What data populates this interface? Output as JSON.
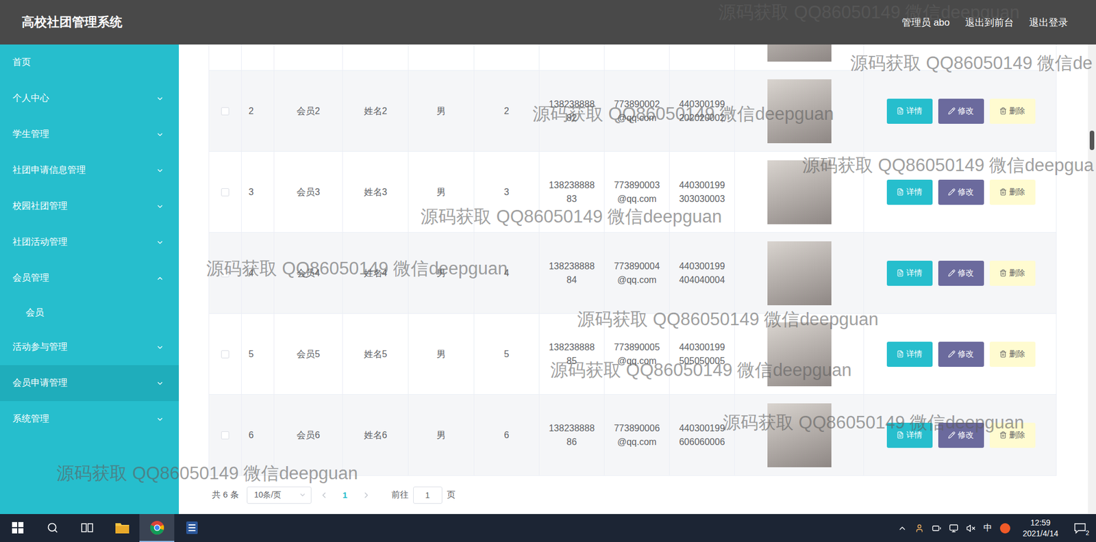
{
  "header": {
    "title": "高校社团管理系统",
    "links": [
      "管理员 abo",
      "退出到前台",
      "退出登录"
    ]
  },
  "sidebar": {
    "items": [
      {
        "label": "首页",
        "kind": "item",
        "expandable": false,
        "expanded": false,
        "highlighted": false
      },
      {
        "label": "个人中心",
        "kind": "item",
        "expandable": true,
        "expanded": false,
        "highlighted": false
      },
      {
        "label": "学生管理",
        "kind": "item",
        "expandable": true,
        "expanded": false,
        "highlighted": false
      },
      {
        "label": "社团申请信息管理",
        "kind": "item",
        "expandable": true,
        "expanded": false,
        "highlighted": false
      },
      {
        "label": "校园社团管理",
        "kind": "item",
        "expandable": true,
        "expanded": false,
        "highlighted": false
      },
      {
        "label": "社团活动管理",
        "kind": "item",
        "expandable": true,
        "expanded": false,
        "highlighted": false
      },
      {
        "label": "会员管理",
        "kind": "item",
        "expandable": true,
        "expanded": true,
        "highlighted": false
      },
      {
        "label": "会员",
        "kind": "subitem",
        "expandable": false,
        "expanded": false,
        "highlighted": false
      },
      {
        "label": "活动参与管理",
        "kind": "item",
        "expandable": true,
        "expanded": false,
        "highlighted": false
      },
      {
        "label": "会员申请管理",
        "kind": "item",
        "expandable": true,
        "expanded": false,
        "highlighted": true
      },
      {
        "label": "系统管理",
        "kind": "item",
        "expandable": true,
        "expanded": false,
        "highlighted": false
      }
    ]
  },
  "table": {
    "rows": [
      {
        "index": "2",
        "account": "会员2",
        "name": "姓名2",
        "gender": "男",
        "age": "2",
        "phone": "13823888882",
        "email": "773890002@qq.com",
        "id_card": "440300199202020002",
        "checked": false
      },
      {
        "index": "3",
        "account": "会员3",
        "name": "姓名3",
        "gender": "男",
        "age": "3",
        "phone": "13823888883",
        "email": "773890003@qq.com",
        "id_card": "440300199303030003",
        "checked": false
      },
      {
        "index": "4",
        "account": "会员4",
        "name": "姓名4",
        "gender": "男",
        "age": "4",
        "phone": "13823888884",
        "email": "773890004@qq.com",
        "id_card": "440300199404040004",
        "checked": false
      },
      {
        "index": "5",
        "account": "会员5",
        "name": "姓名5",
        "gender": "男",
        "age": "5",
        "phone": "13823888885",
        "email": "773890005@qq.com",
        "id_card": "440300199505050005",
        "checked": false
      },
      {
        "index": "6",
        "account": "会员6",
        "name": "姓名6",
        "gender": "男",
        "age": "6",
        "phone": "13823888886",
        "email": "773890006@qq.com",
        "id_card": "440300199606060006",
        "checked": false
      }
    ],
    "actions": [
      {
        "label": "详情",
        "kind": "detail"
      },
      {
        "label": "修改",
        "kind": "edit"
      },
      {
        "label": "删除",
        "kind": "delete"
      }
    ]
  },
  "pagination": {
    "total": "共 6 条",
    "page_size": "10条/页",
    "pages": [
      {
        "label": "1",
        "selected": true
      }
    ],
    "goto_prefix": "前往",
    "goto_value": "1",
    "goto_suffix": "页"
  },
  "watermarks": [
    "源码获取 QQ86050149 微信deepguan",
    "源码获取 QQ86050149 微信de",
    "源码获取 QQ86050149 微信deepguan",
    "源码获取 QQ86050149 微信deepgua",
    "源码获取 QQ86050149 微信deepguan",
    "源码获取 QQ86050149 微信deepguan",
    "源码获取 QQ86050149 微信deepguan",
    "源码获取 QQ86050149 微信deepguan",
    "源码获取 QQ86050149 微信deepguan",
    "源码获取 QQ86050149 微信deepguan"
  ],
  "taskbar": {
    "apps": [
      {
        "kind": "explorer",
        "active": false
      },
      {
        "kind": "chrome",
        "active": true
      },
      {
        "kind": "word",
        "active": false
      }
    ],
    "ime": "中",
    "time": "12:59",
    "date": "2021/4/14",
    "notifications": "2"
  }
}
